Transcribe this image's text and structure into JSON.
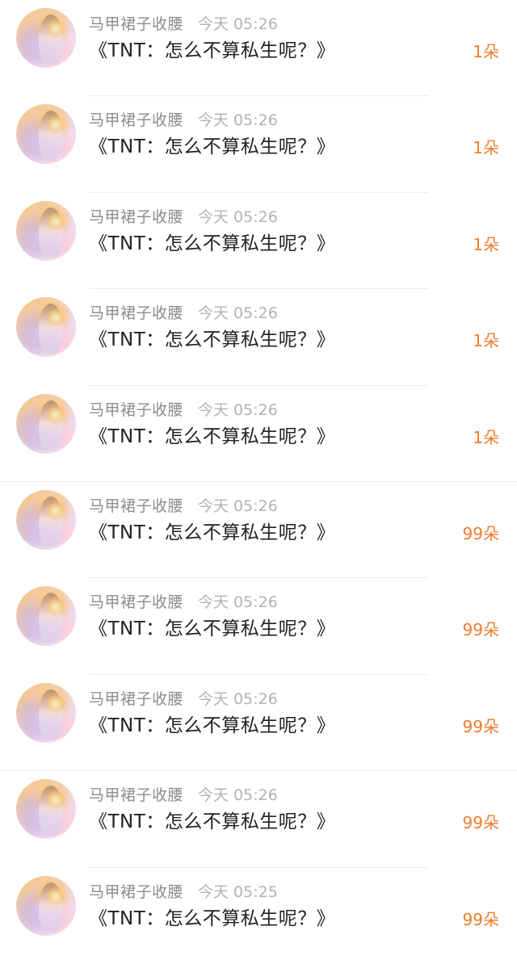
{
  "rows": [
    {
      "username": "马甲裙子收腰",
      "time": "今天 05:26",
      "title": "《TNT：怎么不算私生呢？》",
      "flowers": "1朵"
    },
    {
      "username": "马甲裙子收腰",
      "time": "今天 05:26",
      "title": "《TNT：怎么不算私生呢？》",
      "flowers": "1朵"
    },
    {
      "username": "马甲裙子收腰",
      "time": "今天 05:26",
      "title": "《TNT：怎么不算私生呢？》",
      "flowers": "1朵"
    },
    {
      "username": "马甲裙子收腰",
      "time": "今天 05:26",
      "title": "《TNT：怎么不算私生呢？》",
      "flowers": "1朵"
    },
    {
      "username": "马甲裙子收腰",
      "time": "今天 05:26",
      "title": "《TNT：怎么不算私生呢？》",
      "flowers": "1朵"
    },
    {
      "username": "马甲裙子收腰",
      "time": "今天 05:26",
      "title": "《TNT：怎么不算私生呢？》",
      "flowers": "99朵"
    },
    {
      "username": "马甲裙子收腰",
      "time": "今天 05:26",
      "title": "《TNT：怎么不算私生呢？》",
      "flowers": "99朵"
    },
    {
      "username": "马甲裙子收腰",
      "time": "今天 05:26",
      "title": "《TNT：怎么不算私生呢？》",
      "flowers": "99朵"
    },
    {
      "username": "马甲裙子收腰",
      "time": "今天 05:26",
      "title": "《TNT：怎么不算私生呢？》",
      "flowers": "99朵"
    },
    {
      "username": "马甲裙子收腰",
      "time": "今天 05:25",
      "title": "《TNT：怎么不算私生呢？》",
      "flowers": "99朵"
    }
  ],
  "colors": {
    "accent": "#f07c2a",
    "username": "#8c8c8c",
    "time": "#b3b3b3",
    "title": "#222222"
  }
}
